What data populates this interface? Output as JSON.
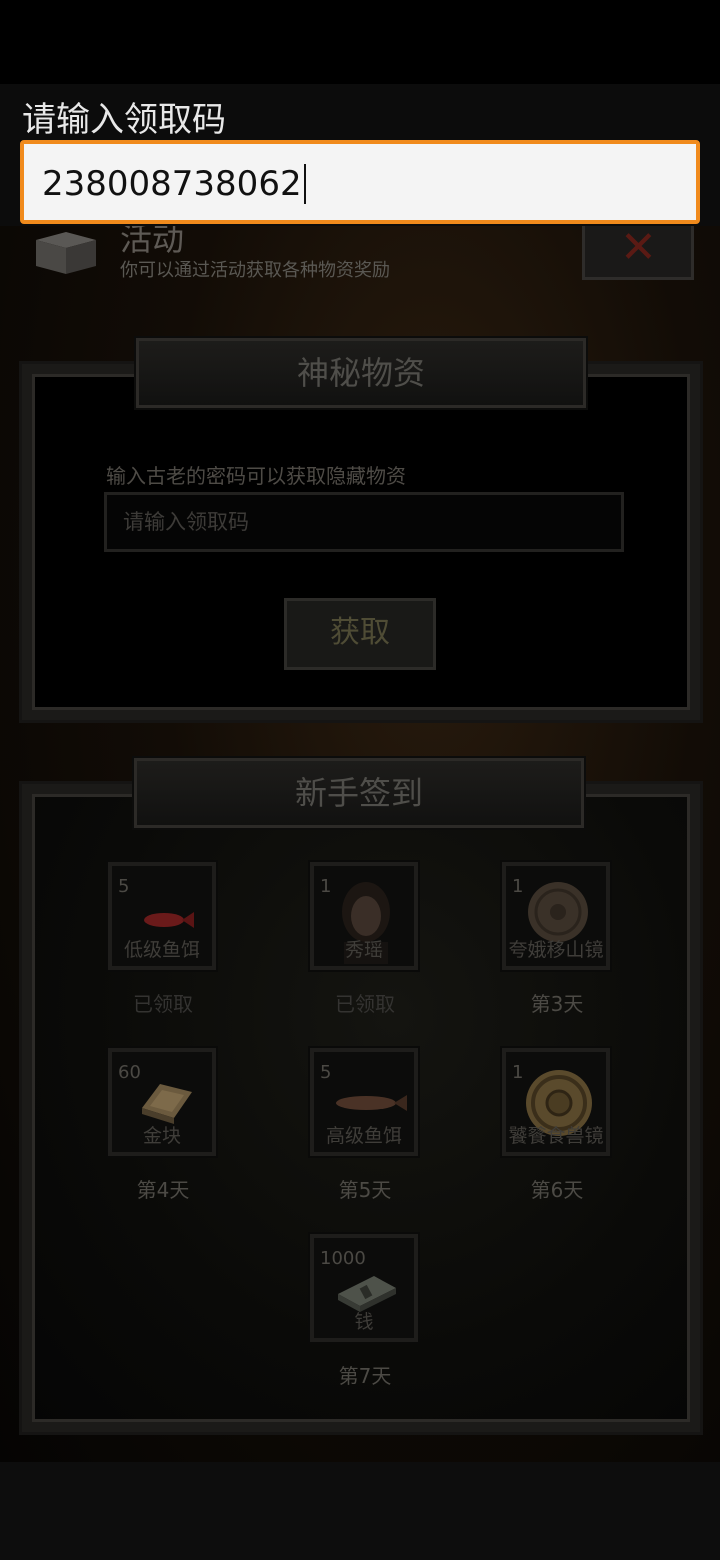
{
  "overlay_input": {
    "label": "请输入领取码",
    "value": "238008738062"
  },
  "activity": {
    "title": "活动",
    "subtitle": "你可以通过活动获取各种物资奖励",
    "close_icon": "close-icon"
  },
  "mystery_supplies": {
    "banner": "神秘物资",
    "hint": "输入古老的密码可以获取隐藏物资",
    "input_placeholder": "请输入领取码",
    "claim_button": "获取"
  },
  "newbie_signin": {
    "banner": "新手签到",
    "rewards": [
      {
        "qty": "5",
        "name": "低级鱼饵",
        "status": "已领取",
        "icon": "red-fish-icon"
      },
      {
        "qty": "1",
        "name": "秀瑶",
        "status": "已领取",
        "icon": "character-portrait"
      },
      {
        "qty": "1",
        "name": "夸娥移山镜",
        "status": "第3天",
        "icon": "bronze-mirror-icon"
      },
      {
        "qty": "60",
        "name": "金块",
        "status": "第4天",
        "icon": "gold-ingot-icon"
      },
      {
        "qty": "5",
        "name": "高级鱼饵",
        "status": "第5天",
        "icon": "brown-fish-icon"
      },
      {
        "qty": "1",
        "name": "饕餮食兽镜",
        "status": "第6天",
        "icon": "golden-mirror-icon"
      },
      {
        "qty": "1000",
        "name": "钱",
        "status": "第7天",
        "icon": "cash-stack-icon"
      }
    ]
  },
  "colors": {
    "accent_border": "#f08a1c",
    "panel_frame": "#1b1a18"
  }
}
